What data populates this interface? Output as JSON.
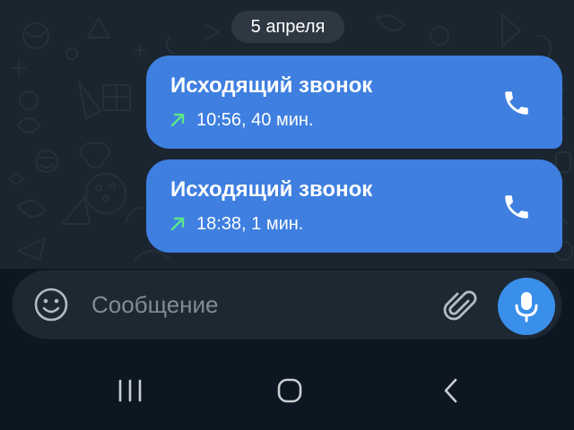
{
  "colors": {
    "bubble": "#3e7fe0",
    "outgoing_arrow": "#5ee68a",
    "mic_button": "#3a8fea",
    "chat_background": "#1b2530"
  },
  "chat": {
    "date_separator": "5 апреля",
    "messages": [
      {
        "title": "Исходящий звонок",
        "meta": "10:56, 40 мин.",
        "direction_icon": "outgoing-arrow-icon",
        "action_icon": "phone-icon"
      },
      {
        "title": "Исходящий звонок",
        "meta": "18:38, 1 мин.",
        "direction_icon": "outgoing-arrow-icon",
        "action_icon": "phone-icon"
      }
    ]
  },
  "composer": {
    "placeholder": "Сообщение",
    "value": "",
    "emoji_icon": "emoji-icon",
    "attach_icon": "paperclip-icon",
    "send_icon": "microphone-icon"
  },
  "navigation": {
    "buttons": [
      "recents-icon",
      "home-icon",
      "back-icon"
    ]
  }
}
